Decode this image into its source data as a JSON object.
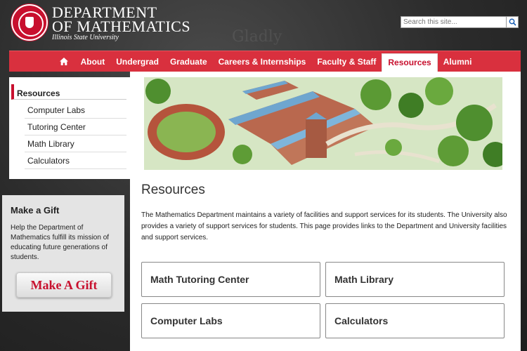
{
  "header": {
    "dept_line1": "DEPARTMENT",
    "dept_line2": "OF MATHEMATICS",
    "university": "Illinois State University",
    "search_placeholder": "Search this site..."
  },
  "nav": {
    "items": [
      "About",
      "Undergrad",
      "Graduate",
      "Careers & Internships",
      "Faculty & Staff",
      "Resources",
      "Alumni"
    ],
    "active": "Resources"
  },
  "sidebar": {
    "title": "Resources",
    "items": [
      "Computer Labs",
      "Tutoring Center",
      "Math Library",
      "Calculators"
    ]
  },
  "gift": {
    "title": "Make a Gift",
    "text": "Help the Department of Mathematics fulfill its mission of educating future generations of students.",
    "button": "Make A Gift"
  },
  "main": {
    "heading": "Resources",
    "intro": "The Mathematics Department maintains a variety of facilities and support services for its students. The University also provides a variety of support services for students. This page provides links to the Department and University facilities and support services.",
    "tiles": [
      "Math Tutoring Center",
      "Math Library",
      "Computer Labs",
      "Calculators"
    ]
  },
  "colors": {
    "brand_red": "#c8102e",
    "nav_red": "#d9303e"
  }
}
